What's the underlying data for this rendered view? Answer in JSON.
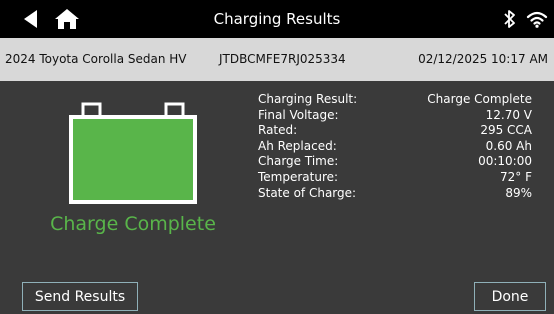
{
  "header": {
    "title": "Charging Results",
    "back_icon": "back-triangle-icon",
    "home_icon": "home-icon",
    "bluetooth_icon": "bluetooth-icon",
    "wifi_icon": "wifi-icon"
  },
  "vehicle_info": {
    "vehicle": "2024 Toyota Corolla Sedan HV",
    "vin": "JTDBCMFE7RJ025334",
    "datetime": "02/12/2025 10:17 AM"
  },
  "battery": {
    "icon": "battery-icon",
    "fill_color": "#59b54a",
    "status_text": "Charge Complete",
    "status_color": "#59b54a"
  },
  "results": [
    {
      "label": "Charging Result:",
      "value": "Charge Complete"
    },
    {
      "label": "Final Voltage:",
      "value": "12.70 V"
    },
    {
      "label": "Rated:",
      "value": "295 CCA"
    },
    {
      "label": "Ah Replaced:",
      "value": "0.60 Ah"
    },
    {
      "label": "Charge Time:",
      "value": "00:10:00"
    },
    {
      "label": "Temperature:",
      "value": "72° F"
    },
    {
      "label": "State of Charge:",
      "value": "89%"
    }
  ],
  "actions": {
    "send_label": "Send Results",
    "done_label": "Done"
  }
}
